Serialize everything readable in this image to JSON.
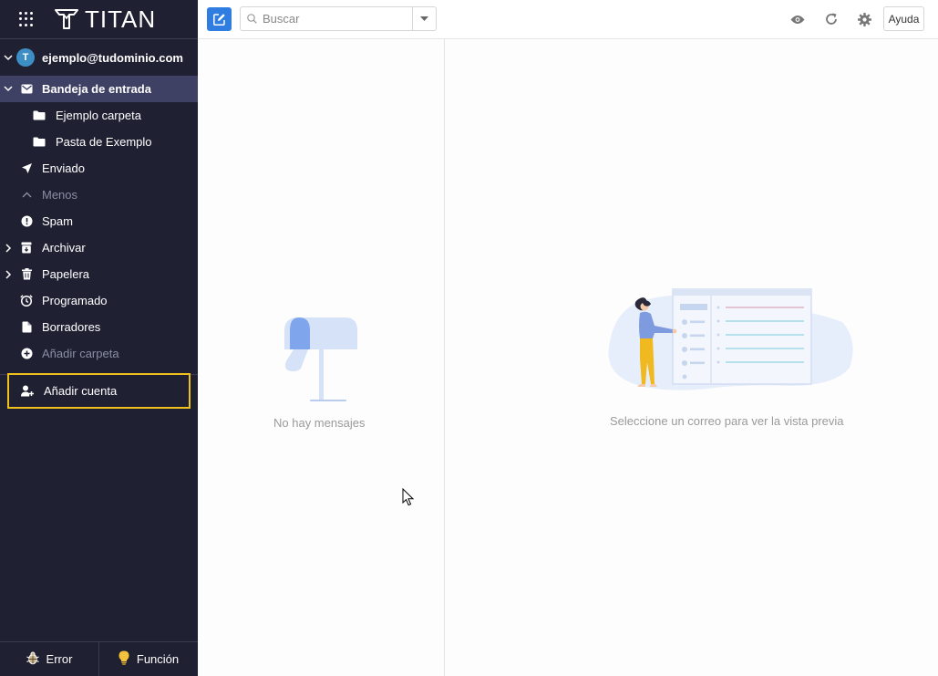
{
  "app": {
    "brand": "TITAN"
  },
  "account": {
    "email": "ejemplo@tudominio.com",
    "avatar_letter": "T"
  },
  "folders": [
    {
      "label": "Bandeja de entrada",
      "icon": "inbox-icon",
      "active": true
    },
    {
      "label": "Ejemplo carpeta",
      "icon": "folder-icon"
    },
    {
      "label": "Pasta de Exemplo",
      "icon": "folder-icon"
    },
    {
      "label": "Enviado",
      "icon": "send-icon"
    },
    {
      "label": "Menos",
      "icon": "chevron-up-icon"
    },
    {
      "label": "Spam",
      "icon": "alert-icon"
    },
    {
      "label": "Archivar",
      "icon": "archive-icon"
    },
    {
      "label": "Papelera",
      "icon": "trash-icon"
    },
    {
      "label": "Programado",
      "icon": "clock-icon"
    },
    {
      "label": "Borradores",
      "icon": "draft-icon"
    },
    {
      "label": "Añadir carpeta",
      "icon": "add-circle-icon"
    }
  ],
  "add_account_label": "Añadir cuenta",
  "bottom": {
    "error_label": "Error",
    "feature_label": "Función"
  },
  "search": {
    "placeholder": "Buscar"
  },
  "toolbar": {
    "help_label": "Ayuda"
  },
  "list": {
    "empty_message": "No hay mensajes"
  },
  "preview": {
    "empty_message": "Seleccione un correo para ver la vista previa"
  },
  "colors": {
    "sidebar_bg": "#1f2133",
    "active_bg": "#3e4064",
    "accent": "#2f7de1",
    "highlight": "#f2c01d"
  }
}
